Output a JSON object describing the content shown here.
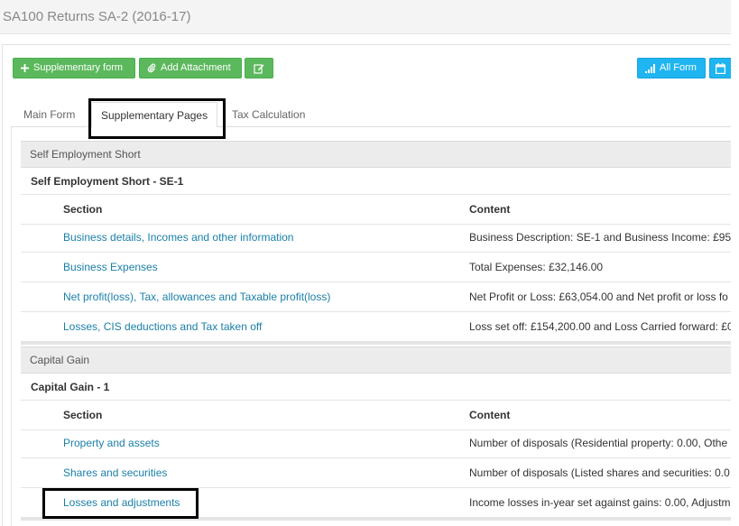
{
  "header": {
    "title": "SA100 Returns SA-2 (2016-17)"
  },
  "toolbar": {
    "supplementary_form": "Supplementary form",
    "add_attachment": "Add Attachment",
    "all_form": "All Form"
  },
  "tabs": [
    {
      "label": "Main Form"
    },
    {
      "label": "Supplementary Pages"
    },
    {
      "label": "Tax Calculation"
    }
  ],
  "groups": [
    {
      "title": "Self Employment Short",
      "subtitle": "Self Employment Short - SE-1",
      "col_section": "Section",
      "col_content": "Content",
      "rows": [
        {
          "section": "Business details, Incomes and other information",
          "content": "Business Description: SE-1 and Business Income: £95,"
        },
        {
          "section": "Business Expenses",
          "content": "Total Expenses: £32,146.00"
        },
        {
          "section": "Net profit(loss), Tax, allowances and Taxable profit(loss)",
          "content": "Net Profit or Loss: £63,054.00 and Net profit or loss fo"
        },
        {
          "section": "Losses, CIS deductions and Tax taken off",
          "content": "Loss set off: £154,200.00 and Loss Carried forward: £0"
        }
      ]
    },
    {
      "title": "Capital Gain",
      "subtitle": "Capital Gain - 1",
      "col_section": "Section",
      "col_content": "Content",
      "rows": [
        {
          "section": "Property and assets",
          "content": "Number of disposals (Residential property: 0.00, Othe"
        },
        {
          "section": "Shares and securities",
          "content": "Number of disposals (Listed shares and securities: 0.0"
        },
        {
          "section": "Losses and adjustments",
          "content": "Income losses in-year set against gains: 0.00, Adjustm"
        }
      ]
    }
  ],
  "colors": {
    "green": "#5cb85c",
    "blue": "#1fb5f0",
    "link": "#1a7fa8"
  }
}
